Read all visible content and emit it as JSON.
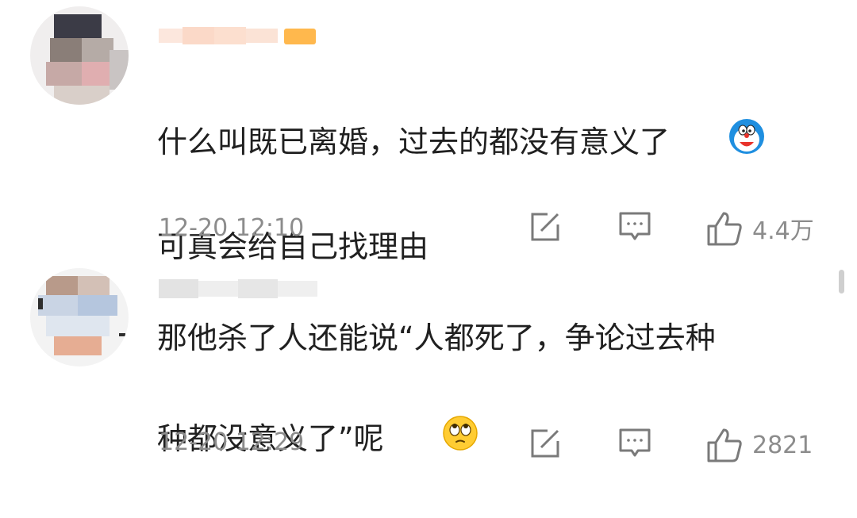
{
  "comments": [
    {
      "text": "什么叫既已离婚，过去的都没有意义了",
      "text_line2": "可真会给自己找理由",
      "emoji": "doraemon-emoji",
      "timestamp": "12-20 12:10",
      "likes": "4.4万"
    },
    {
      "text": "那他杀了人还能说“人都死了，争论过去种",
      "text_line2": "种都没意义了”呢",
      "emoji": "eye-roll-emoji",
      "timestamp": "12-20 12:29",
      "likes": "2821"
    }
  ],
  "icons": {
    "share": "share-edit-icon",
    "reply": "comment-bubble-icon",
    "like": "thumbs-up-icon"
  },
  "colors": {
    "text": "#202020",
    "meta": "#8c8c8c",
    "icon": "#7a7a7a",
    "badge": "#ffb84d"
  }
}
